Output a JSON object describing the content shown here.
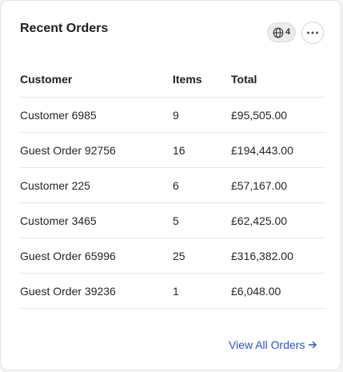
{
  "card": {
    "title": "Recent Orders",
    "language_count": "4",
    "language_icon": "globe-icon",
    "more_icon": "more-horizontal-icon"
  },
  "table": {
    "headers": {
      "customer": "Customer",
      "items": "Items",
      "total": "Total"
    },
    "rows": [
      {
        "customer": "Customer 6985",
        "items": "9",
        "total": "£95,505.00"
      },
      {
        "customer": "Guest Order 92756",
        "items": "16",
        "total": "£194,443.00"
      },
      {
        "customer": "Customer 225",
        "items": "6",
        "total": "£57,167.00"
      },
      {
        "customer": "Customer 3465",
        "items": "5",
        "total": "£62,425.00"
      },
      {
        "customer": "Guest Order 65996",
        "items": "25",
        "total": "£316,382.00"
      },
      {
        "customer": "Guest Order 39236",
        "items": "1",
        "total": "£6,048.00"
      }
    ]
  },
  "footer": {
    "view_all_label": "View All Orders",
    "view_all_icon": "arrow-right-icon"
  },
  "colors": {
    "link": "#2b4fd8",
    "divider": "#e6e6e6",
    "card_background": "#ffffff",
    "page_background": "#f5f5f5"
  }
}
